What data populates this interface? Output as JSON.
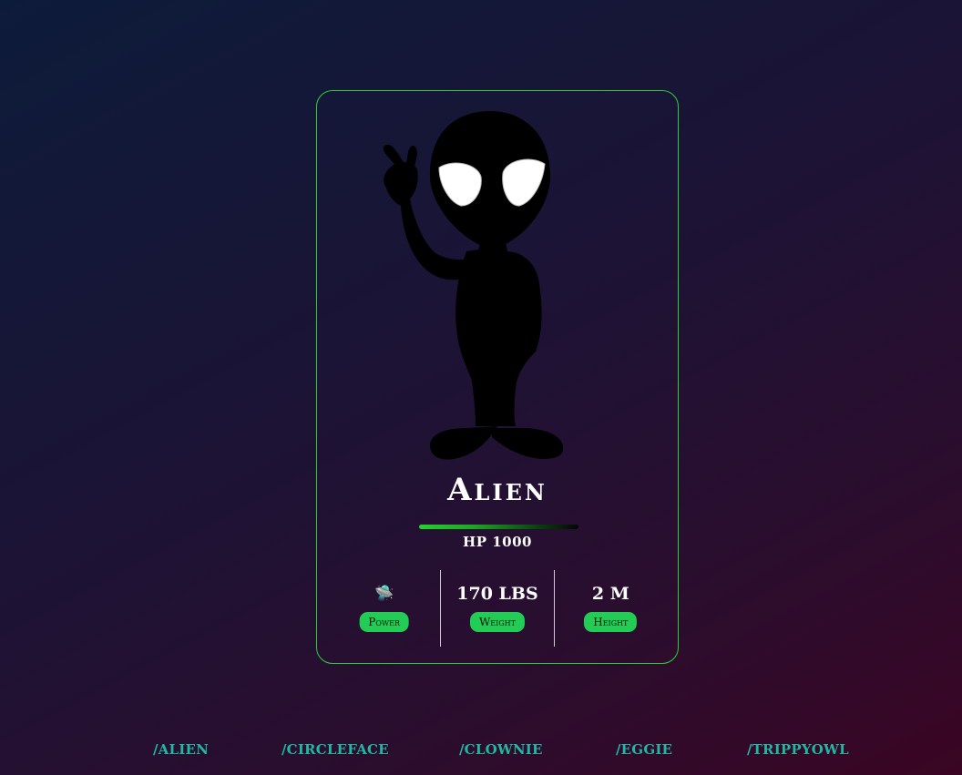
{
  "character": {
    "name": "Alien",
    "hp_label": "HP 1000",
    "hp_fill_percent": 100,
    "image_icon": "alien-silhouette-icon"
  },
  "stats": [
    {
      "value": "🛸",
      "label": "Power"
    },
    {
      "value": "170 LBS",
      "label": "Weight"
    },
    {
      "value": "2 M",
      "label": "Height"
    }
  ],
  "nav": {
    "links": [
      "/ALIEN",
      "/CIRCLEFACE",
      "/CLOWNIE",
      "/EGGIE",
      "/TRIPPYOWL"
    ]
  },
  "colors": {
    "card_border": "#2ad13a",
    "pill_bg": "#22cc55",
    "nav_link": "#1fb8a2",
    "hp_bar": "#22d32a"
  }
}
